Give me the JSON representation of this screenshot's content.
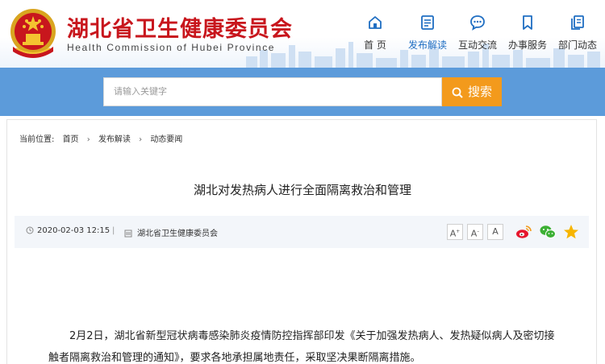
{
  "site": {
    "title": "湖北省卫生健康委员会",
    "subtitle": "Health Commission of Hubei Province",
    "brand_red": "#c8161d"
  },
  "nav": {
    "items": [
      {
        "label": "首 页",
        "icon": "home-icon",
        "active": false
      },
      {
        "label": "发布解读",
        "icon": "document-icon",
        "active": true
      },
      {
        "label": "互动交流",
        "icon": "chat-bubble-icon",
        "active": false
      },
      {
        "label": "办事服务",
        "icon": "bookmark-icon",
        "active": false
      },
      {
        "label": "部门动态",
        "icon": "pages-icon",
        "active": false
      }
    ],
    "accent": "#1f6ec2"
  },
  "search": {
    "placeholder": "请输入关键字",
    "button_label": "搜索",
    "band_color": "#5c9bda",
    "button_color": "#f39a1c"
  },
  "breadcrumb": {
    "prefix": "当前位置:",
    "items": [
      "首页",
      "发布解读",
      "动态要闻"
    ],
    "separator": "›"
  },
  "article": {
    "title": "湖北对发热病人进行全面隔离救治和管理",
    "date": "2020-02-03 12:15",
    "divider": "|",
    "source": "湖北省卫生健康委员会",
    "font_sizes": [
      "A+",
      "A",
      "A"
    ],
    "share": [
      "weibo-icon",
      "wechat-icon",
      "favorite-star-icon"
    ],
    "body": "2月2日，湖北省新型冠状病毒感染肺炎疫情防控指挥部印发《关于加强发热病人、发热疑似病人及密切接触者隔离救治和管理的通知》，要求各地承担属地责任，采取坚决果断隔离措施。"
  }
}
